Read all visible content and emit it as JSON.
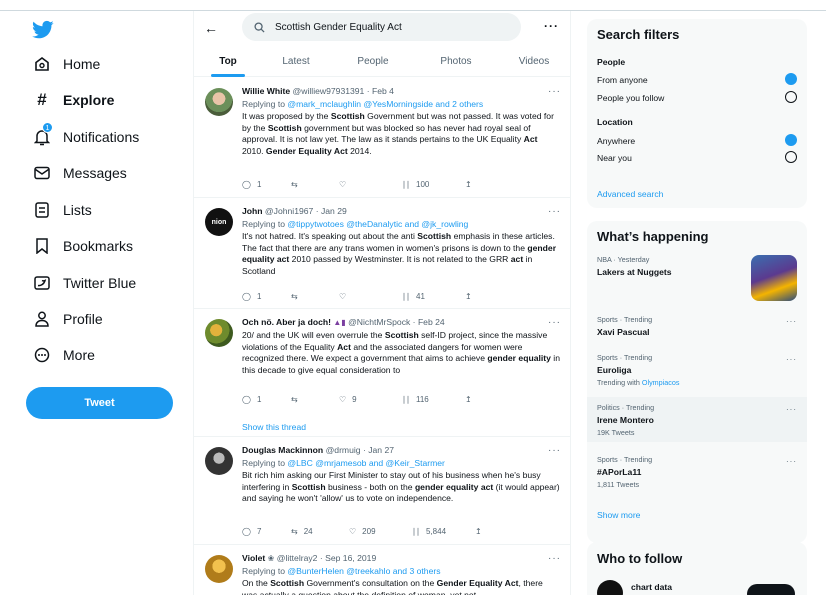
{
  "nav": {
    "items": [
      {
        "label": "Home",
        "icon": "home-icon"
      },
      {
        "label": "Explore",
        "icon": "hashtag-icon"
      },
      {
        "label": "Notifications",
        "icon": "bell-icon",
        "badge": "1"
      },
      {
        "label": "Messages",
        "icon": "envelope-icon"
      },
      {
        "label": "Lists",
        "icon": "list-icon"
      },
      {
        "label": "Bookmarks",
        "icon": "bookmark-icon"
      },
      {
        "label": "Twitter Blue",
        "icon": "twitter-blue-icon"
      },
      {
        "label": "Profile",
        "icon": "person-icon"
      },
      {
        "label": "More",
        "icon": "more-circle-icon"
      }
    ],
    "tweet_button": "Tweet"
  },
  "search": {
    "query": "Scottish Gender Equality Act"
  },
  "tabs": [
    "Top",
    "Latest",
    "People",
    "Photos",
    "Videos"
  ],
  "tweets": [
    {
      "name": "Willie White",
      "handle": "@williew97931391",
      "date": "Feb 4",
      "reply_prefix": "Replying to",
      "reply_to": "@mark_mclaughlin @YesMorningside and 2 others",
      "text_parts": [
        {
          "t": "It was proposed by the "
        },
        {
          "t": "Scottish",
          "b": true
        },
        {
          "t": " Government but was not passed. It was voted for by the "
        },
        {
          "t": "Scottish",
          "b": true
        },
        {
          "t": " government but was blocked so has never had royal seal of approval. It is not law yet. The law as it stands pertains to the UK Equality "
        },
        {
          "t": "Act",
          "b": true
        },
        {
          "t": " 2010. "
        },
        {
          "t": "Gender Equality Act",
          "b": true
        },
        {
          "t": " 2014."
        }
      ],
      "replies": "1",
      "retweets": "",
      "likes": "",
      "views": "100"
    },
    {
      "name": "John",
      "handle": "@Johni1967",
      "date": "Jan 29",
      "reply_prefix": "Replying to",
      "reply_to": "@tippytwotoes @theDanalytic and @jk_rowling",
      "text_parts": [
        {
          "t": "It's not hatred. It's speaking out about the anti "
        },
        {
          "t": "Scottish",
          "b": true
        },
        {
          "t": " emphasis in these articles. The fact that there are any trans women in women's prisons is down to the "
        },
        {
          "t": "gender equality act",
          "b": true
        },
        {
          "t": " 2010 passed by Westminster. It is not related to the GRR "
        },
        {
          "t": "act",
          "b": true
        },
        {
          "t": " in Scotland"
        }
      ],
      "replies": "1",
      "retweets": "",
      "likes": "",
      "views": "41"
    },
    {
      "name": "Och nö. Aber ja doch!",
      "handle": "@NichtMrSpock",
      "date": "Feb 24",
      "text_parts": [
        {
          "t": "20/ and the UK will even overrule the "
        },
        {
          "t": "Scottish",
          "b": true
        },
        {
          "t": " self-ID project, since the massive violations of the Equality "
        },
        {
          "t": "Act",
          "b": true
        },
        {
          "t": " and the associated dangers for women were recognized there. We expect a government that aims to achieve "
        },
        {
          "t": "gender equality",
          "b": true
        },
        {
          "t": " in this decade to give equal consideration to"
        }
      ],
      "replies": "1",
      "retweets": "",
      "likes": "9",
      "views": "116",
      "show_thread": "Show this thread"
    },
    {
      "name": "Douglas Mackinnon",
      "handle": "@drmuig",
      "date": "Jan 27",
      "reply_prefix": "Replying to",
      "reply_to": "@LBC @mrjamesob and @Keir_Starmer",
      "text_parts": [
        {
          "t": "Bit rich him asking our First Minister to stay out of his business when he's busy interfering in "
        },
        {
          "t": "Scottish",
          "b": true
        },
        {
          "t": " business - both on the "
        },
        {
          "t": "gender equality act",
          "b": true
        },
        {
          "t": " (it would appear) and saying he won't 'allow' us to vote on independence."
        }
      ],
      "replies": "7",
      "retweets": "24",
      "likes": "209",
      "views": "5,844"
    },
    {
      "name": "Violet",
      "handle": "@littelray2",
      "date": "Sep 16, 2019",
      "reply_prefix": "Replying to",
      "reply_to": "@BunterHelen @treekahlo and 3 others",
      "text_parts": [
        {
          "t": "On the "
        },
        {
          "t": "Scottish",
          "b": true
        },
        {
          "t": " Government's consultation on the "
        },
        {
          "t": "Gender Equality Act",
          "b": true
        },
        {
          "t": ", there was actually a question about the definition of woman, yet not"
        }
      ],
      "replies": "",
      "retweets": "",
      "likes": "",
      "views": ""
    }
  ],
  "search_filters": {
    "title": "Search filters",
    "people_label": "People",
    "people_options": [
      {
        "label": "From anyone",
        "selected": true
      },
      {
        "label": "People you follow",
        "selected": false
      }
    ],
    "location_label": "Location",
    "location_options": [
      {
        "label": "Anywhere",
        "selected": true
      },
      {
        "label": "Near you",
        "selected": false
      }
    ],
    "advanced": "Advanced search"
  },
  "happening": {
    "title": "What’s happening",
    "trends": [
      {
        "meta": "NBA · Yesterday",
        "title": "Lakers at Nuggets",
        "count": "",
        "has_image": true
      },
      {
        "meta": "Sports · Trending",
        "title": "Xavi Pascual",
        "count": ""
      },
      {
        "meta": "Sports · Trending",
        "title": "Euroliga",
        "count": "",
        "with_prefix": "Trending with",
        "with_link": "Olympiacos"
      },
      {
        "meta": "Politics · Trending",
        "title": "Irene Montero",
        "count": "19K Tweets"
      },
      {
        "meta": "Sports · Trending",
        "title": "#APorLa11",
        "count": "1,811 Tweets"
      }
    ],
    "show_more": "Show more"
  },
  "who_to_follow": {
    "title": "Who to follow",
    "first_name": "chart data"
  },
  "colors": {
    "accent": "#1d9bf0",
    "text": "#0f1419",
    "muted": "#536471",
    "panel": "#f7f9f9"
  }
}
